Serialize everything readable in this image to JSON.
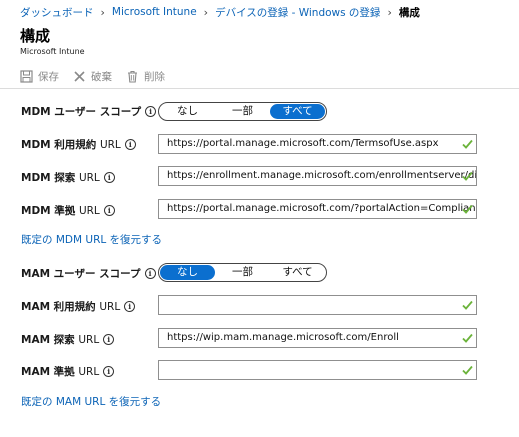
{
  "breadcrumb": {
    "items": [
      "ダッシュボード",
      "Microsoft Intune",
      "デバイスの登録 - Windows の登録",
      "構成"
    ]
  },
  "page": {
    "title": "構成",
    "subtitle": "Microsoft Intune"
  },
  "toolbar": {
    "save_label": "保存",
    "discard_label": "破棄",
    "delete_label": "削除"
  },
  "mdm": {
    "scope": {
      "label": "MDM ユーザー スコープ",
      "options": [
        "なし",
        "一部",
        "すべて"
      ],
      "selected": "すべて"
    },
    "terms_url": {
      "label_strong": "MDM 利用規約",
      "label_light": "URL",
      "value": "https://portal.manage.microsoft.com/TermsofUse.aspx"
    },
    "discovery_url": {
      "label_strong": "MDM 探索",
      "label_light": "URL",
      "value": "https://enrollment.manage.microsoft.com/enrollmentserver/discovery.svc"
    },
    "compliance_url": {
      "label_strong": "MDM 準拠",
      "label_light": "URL",
      "value": "https://portal.manage.microsoft.com/?portalAction=Compliance"
    },
    "restore_link": "既定の MDM URL を復元する"
  },
  "mam": {
    "scope": {
      "label": "MAM ユーザー スコープ",
      "options": [
        "なし",
        "一部",
        "すべて"
      ],
      "selected": "なし"
    },
    "terms_url": {
      "label_strong": "MAM 利用規約",
      "label_light": "URL",
      "value": ""
    },
    "discovery_url": {
      "label_strong": "MAM 探索",
      "label_light": "URL",
      "value": "https://wip.mam.manage.microsoft.com/Enroll"
    },
    "compliance_url": {
      "label_strong": "MAM 準拠",
      "label_light": "URL",
      "value": ""
    },
    "restore_link": "既定の MAM URL を復元する"
  },
  "icons": {
    "info": "info-icon",
    "check": "checkmark-icon",
    "save": "save-icon",
    "discard": "close-icon",
    "delete": "trash-icon"
  },
  "colors": {
    "link": "#0b63b6",
    "toggle_selected": "#0b6fcf",
    "check": "#6bb33a",
    "disabled_text": "#8a8a8a"
  }
}
